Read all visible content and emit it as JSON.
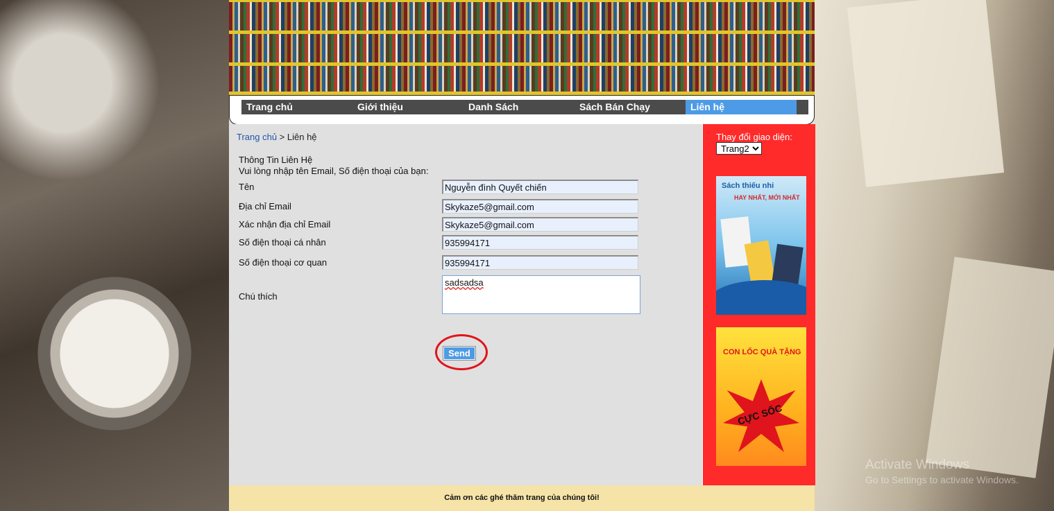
{
  "nav": {
    "items": [
      {
        "label": "Trang chủ"
      },
      {
        "label": "Giới thiệu"
      },
      {
        "label": "Danh Sách"
      },
      {
        "label": "Sách Bán Chạy"
      },
      {
        "label": "Liên hệ",
        "active": true
      }
    ]
  },
  "breadcrumb": {
    "home": "Trang chủ",
    "separator": " > ",
    "current": "Liên hệ"
  },
  "form": {
    "title": "Thông Tin Liên Hệ",
    "subtitle": "Vui lòng nhập tên Email, Số điện thoại của bạn:",
    "fields": {
      "name": {
        "label": "Tên",
        "value": "Nguyễn đình Quyết chiến"
      },
      "email": {
        "label": "Địa chỉ Email",
        "value": "Skykaze5@gmail.com"
      },
      "email_confirm": {
        "label": "Xác nhận địa chỉ Email",
        "value": "Skykaze5@gmail.com"
      },
      "phone_personal": {
        "label": "Số điện thoại cá nhân",
        "value": "935994171"
      },
      "phone_office": {
        "label": "Số điện thoại cơ quan",
        "value": "935994171"
      },
      "note": {
        "label": "Chú thích",
        "value": "sadsadsa"
      }
    },
    "send_label": "Send"
  },
  "sidebar": {
    "theme_label": "Thay đổi giao diện:",
    "theme_selected": "Trang2",
    "ad1": {
      "line1": "Sách thiếu nhi",
      "line2": "HAY NHẤT, MỚI NHẤT"
    },
    "ad2": {
      "line1": "CON LỐC QUÀ TẶNG",
      "line2": "CỰC SỐC"
    }
  },
  "footer": {
    "text": "Cảm ơn các ghé thăm trang của chúng tôi!"
  },
  "watermark": {
    "title": "Activate Windows",
    "subtitle": "Go to Settings to activate Windows."
  },
  "colors": {
    "nav_bg": "#4b4b4b",
    "nav_active": "#4d9be6",
    "sidebar_bg": "#ff2a2a",
    "footer_bg": "#f5e3a8",
    "highlight_ring": "#e1141c"
  }
}
